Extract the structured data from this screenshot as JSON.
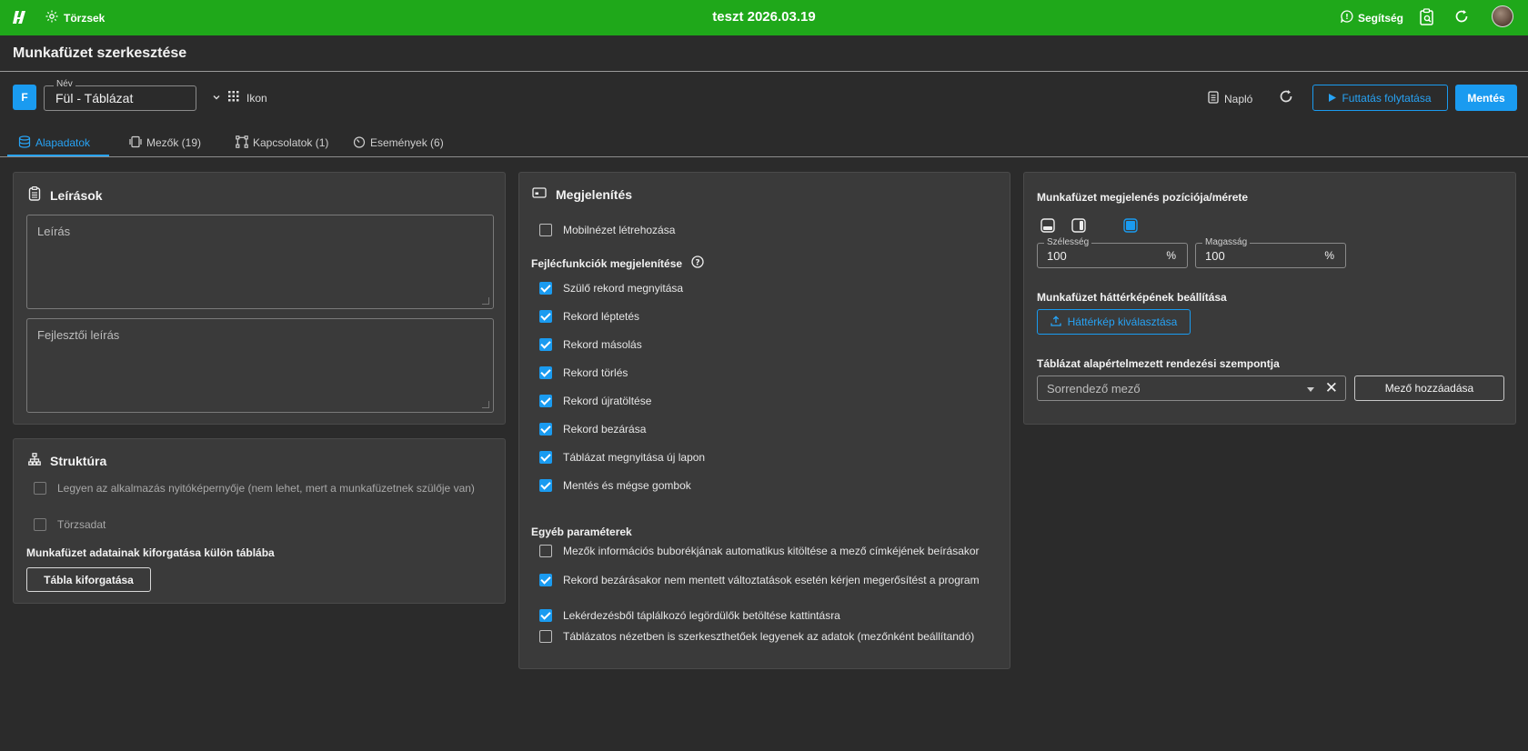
{
  "topbar": {
    "torzsek_label": "Törzsek",
    "title": "teszt 2026.03.19",
    "help_label": "Segítség"
  },
  "header": {
    "page_title": "Munkafüzet szerkesztése",
    "badge": "F",
    "name_legend": "Név",
    "name_value": "Fül - Táblázat",
    "ikon_label": "Ikon",
    "naplo_label": "Napló",
    "run_label": "Futtatás folytatása",
    "save_label": "Mentés"
  },
  "tabs": [
    {
      "label": "Alapadatok",
      "active": true
    },
    {
      "label": "Mezők (19)",
      "active": false
    },
    {
      "label": "Kapcsolatok (1)",
      "active": false
    },
    {
      "label": "Események (6)",
      "active": false
    }
  ],
  "leirasok": {
    "title": "Leírások",
    "leiras_placeholder": "Leírás",
    "fejlesztoi_placeholder": "Fejlesztői leírás"
  },
  "struktura": {
    "title": "Struktúra",
    "checkboxes": [
      {
        "label": "Legyen az alkalmazás nyitóképernyője (nem lehet, mert a munkafüzetnek szülője van)",
        "checked": false,
        "disabled": true
      },
      {
        "label": "Törzsadat",
        "checked": false,
        "disabled": true
      }
    ],
    "kiforgatas_label": "Munkafüzet adatainak kiforgatása külön táblába",
    "kiforgatas_button": "Tábla kiforgatása"
  },
  "megjelenites": {
    "title": "Megjelenítés",
    "mobile_label": "Mobilnézet létrehozása",
    "mobile_checked": false,
    "fejlec_label": "Fejlécfunkciók megjelenítése",
    "fejlec_items": [
      {
        "label": "Szülő rekord megnyitása",
        "checked": true
      },
      {
        "label": "Rekord léptetés",
        "checked": true
      },
      {
        "label": "Rekord másolás",
        "checked": true
      },
      {
        "label": "Rekord törlés",
        "checked": true
      },
      {
        "label": "Rekord újratöltése",
        "checked": true
      },
      {
        "label": "Rekord bezárása",
        "checked": true
      },
      {
        "label": "Táblázat megnyitása új lapon",
        "checked": true
      },
      {
        "label": "Mentés és mégse gombok",
        "checked": true
      }
    ],
    "egyeb_label": "Egyéb paraméterek",
    "egyeb_items": [
      {
        "label": "Mezők információs buborékjának automatikus kitöltése a mező címkéjének beírásakor",
        "checked": false
      },
      {
        "label": "Rekord bezárásakor nem mentett változtatások esetén kérjen megerősítést a program",
        "checked": true
      },
      {
        "label": "Lekérdezésből táplálkozó legördülők betöltése kattintásra",
        "checked": true
      },
      {
        "label": "Táblázatos nézetben is szerkeszthetőek legyenek az adatok (mezőnként beállítandó)",
        "checked": false
      }
    ]
  },
  "pozicio": {
    "title": "Munkafüzet megjelenés pozíciója/mérete",
    "szelesseg_legend": "Szélesség",
    "szelesseg_value": "100",
    "magassag_legend": "Magasság",
    "magassag_value": "100",
    "unit": "%",
    "hatterkep_label": "Munkafüzet háttérképének beállítása",
    "hatterkep_button": "Háttérkép kiválasztása",
    "rendezes_label": "Táblázat alapértelmezett rendezési szempontja",
    "rendezes_placeholder": "Sorrendező mező",
    "clear_symbol": "✕",
    "mezo_hozzaadasa": "Mező hozzáadása"
  },
  "colors": {
    "topbar": "#1fa81a",
    "accent": "#1a9bf0",
    "background": "#2b2b2b",
    "panel": "#3a3a3a"
  }
}
